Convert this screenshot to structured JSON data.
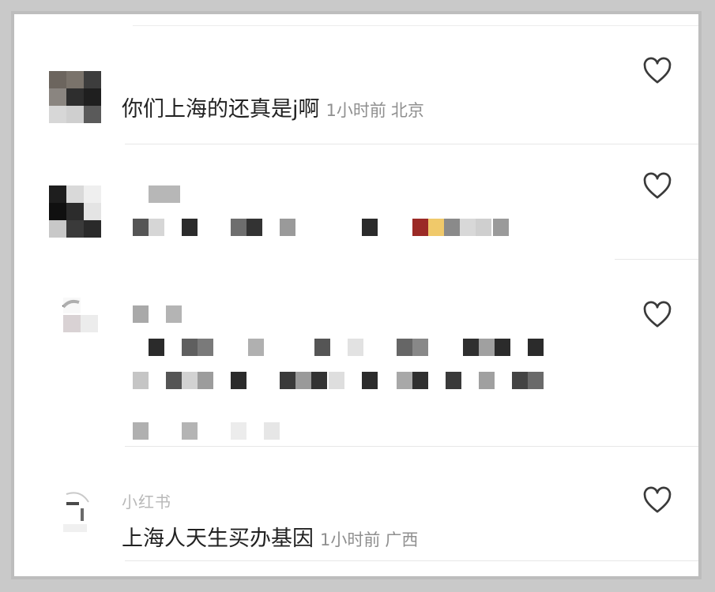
{
  "comments": [
    {
      "username": "",
      "text": "你们上海的还真是j啊",
      "time": "1小时前",
      "location": "北京"
    },
    {
      "username": "",
      "text": "",
      "time": "",
      "location": ""
    },
    {
      "username": "",
      "text": "",
      "time": "",
      "location": ""
    },
    {
      "username": "小红书",
      "text": "上海人天生买办基因",
      "time": "1小时前",
      "location": "广西"
    }
  ],
  "icons": {
    "like": "heart-outline-icon"
  },
  "colors": {
    "text": "#222222",
    "meta": "#8f8f8f",
    "username": "#b8b8b8",
    "divider": "#e7e7e7",
    "mosaic_dark": "#2b2b2b",
    "mosaic_mid": "#6e6e6e",
    "mosaic_light": "#b3b3b3",
    "mosaic_red": "#9b2a26",
    "mosaic_yellow": "#f0c96a"
  }
}
